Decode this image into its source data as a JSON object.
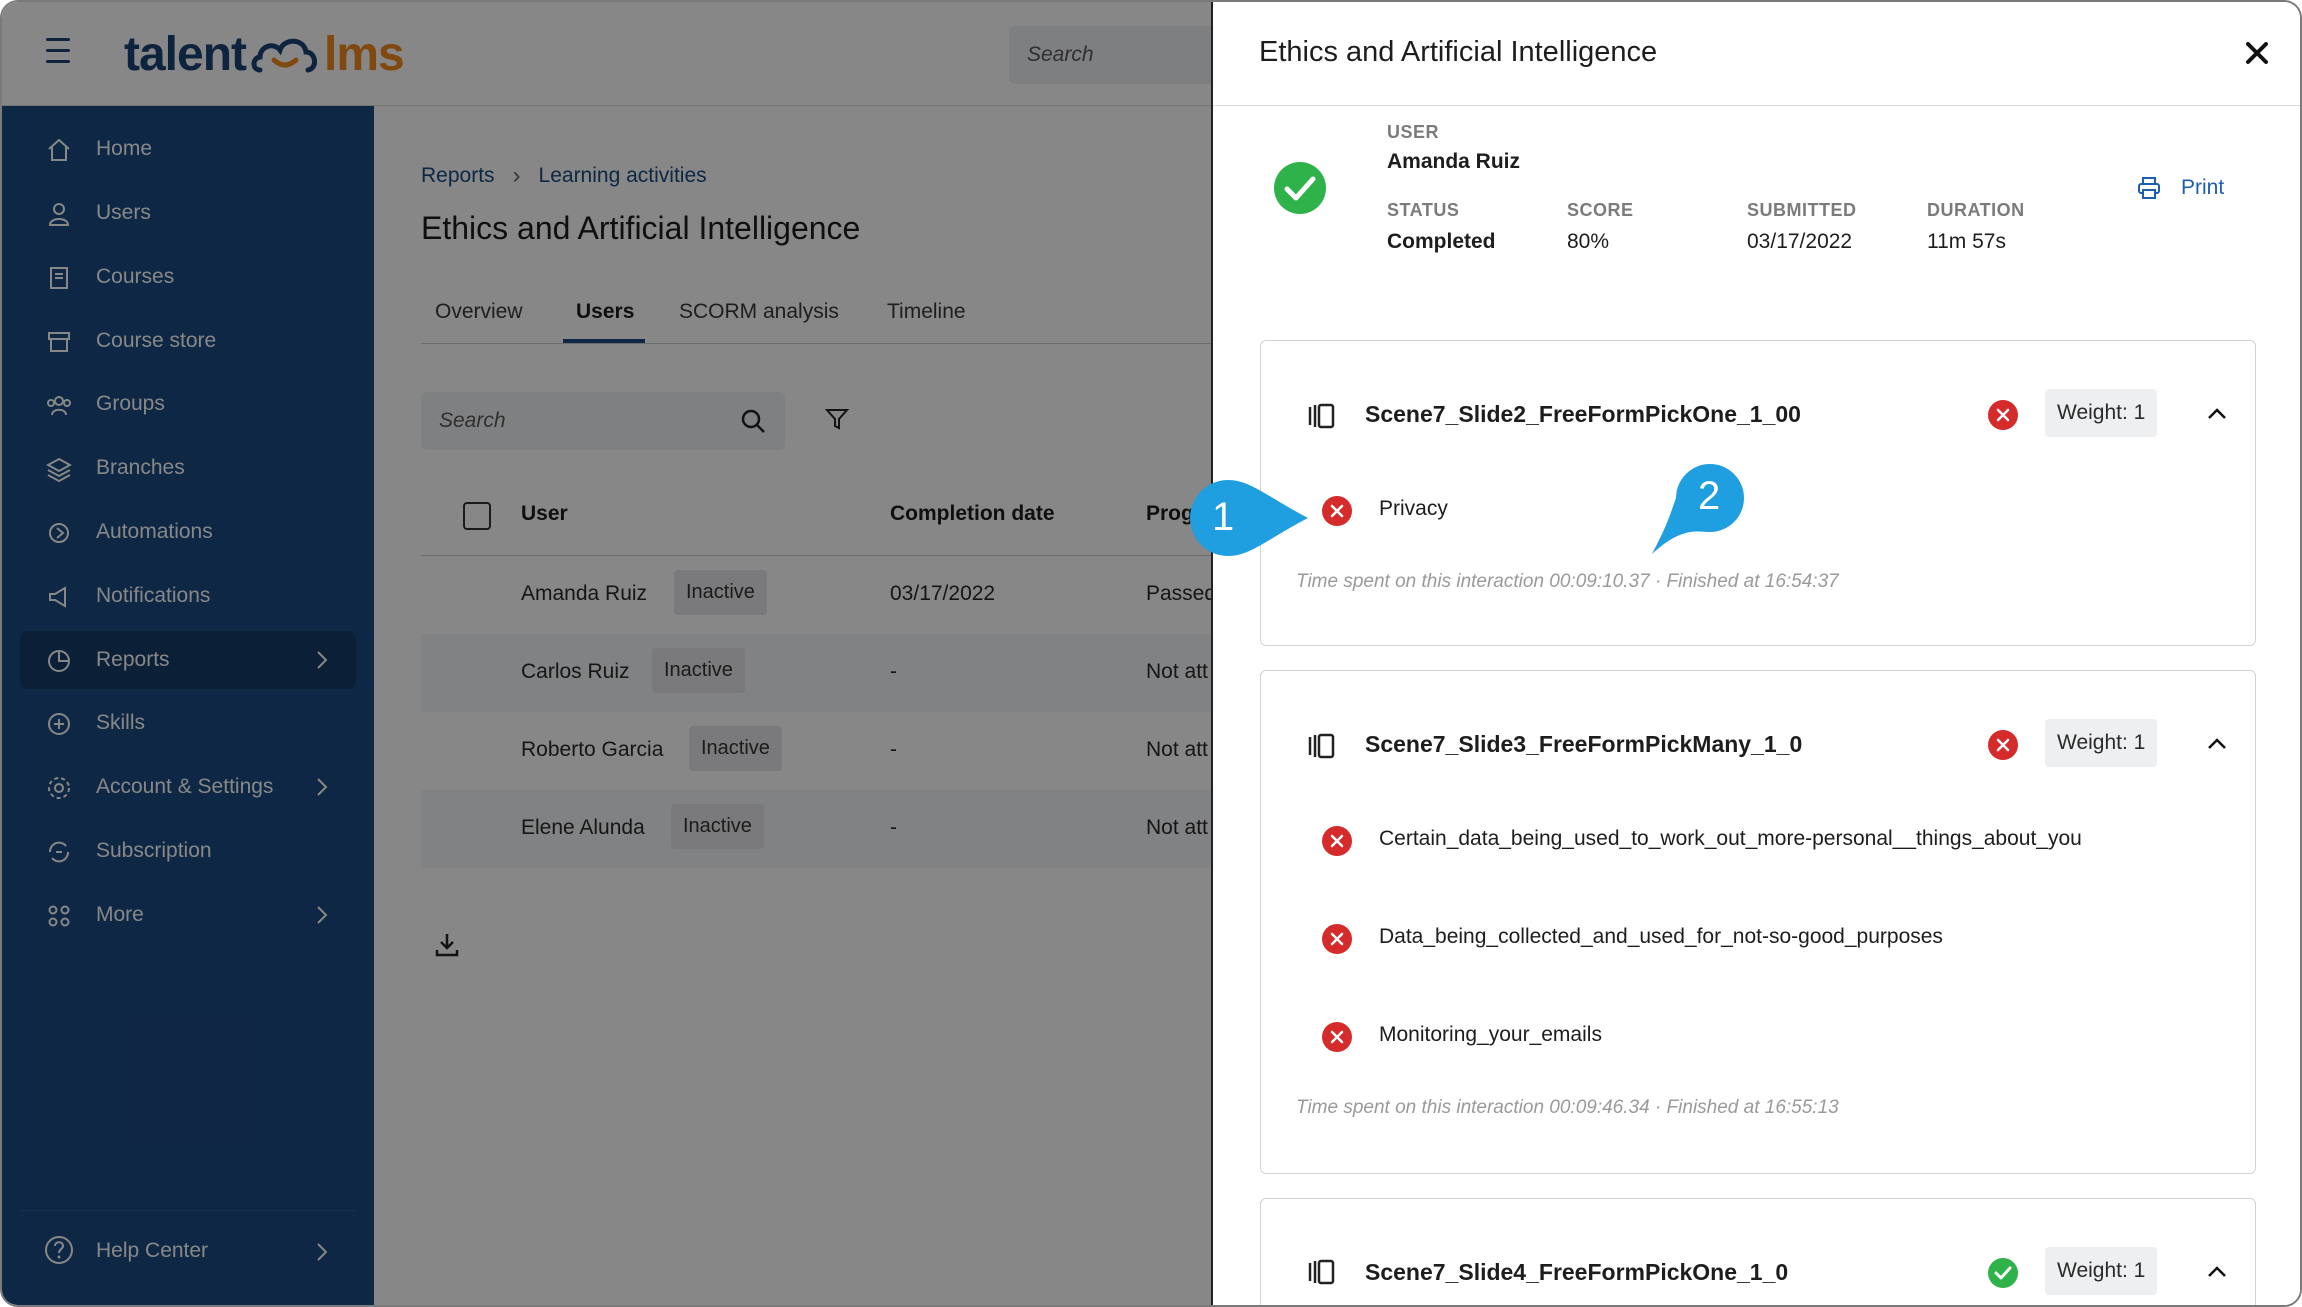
{
  "app": {
    "logo_left": "talent",
    "logo_right": "lms",
    "search_placeholder": "Search"
  },
  "sidebar": {
    "items": [
      {
        "label": "Home",
        "icon": "home-icon"
      },
      {
        "label": "Users",
        "icon": "user-icon"
      },
      {
        "label": "Courses",
        "icon": "book-icon"
      },
      {
        "label": "Course store",
        "icon": "store-icon"
      },
      {
        "label": "Groups",
        "icon": "groups-icon"
      },
      {
        "label": "Branches",
        "icon": "layers-icon"
      },
      {
        "label": "Automations",
        "icon": "automation-icon"
      },
      {
        "label": "Notifications",
        "icon": "megaphone-icon"
      },
      {
        "label": "Reports",
        "icon": "pie-chart-icon",
        "active": true
      },
      {
        "label": "Skills",
        "icon": "skills-icon"
      },
      {
        "label": "Account & Settings",
        "icon": "gear-icon"
      },
      {
        "label": "Subscription",
        "icon": "subscription-icon"
      },
      {
        "label": "More",
        "icon": "grid-icon"
      }
    ],
    "help": "Help Center"
  },
  "main": {
    "breadcrumb": [
      "Reports",
      "Learning activities"
    ],
    "title": "Ethics and Artificial Intelligence",
    "tabs": [
      "Overview",
      "Users",
      "SCORM analysis",
      "Timeline"
    ],
    "active_tab": "Users",
    "search_placeholder": "Search",
    "columns": [
      "User",
      "Completion date",
      "Prog"
    ],
    "rows": [
      {
        "user": "Amanda Ruiz",
        "status": "Inactive",
        "date": "03/17/2022",
        "progress": "Passed"
      },
      {
        "user": "Carlos Ruiz",
        "status": "Inactive",
        "date": "-",
        "progress": "Not att"
      },
      {
        "user": "Roberto Garcia",
        "status": "Inactive",
        "date": "-",
        "progress": "Not att"
      },
      {
        "user": "Elene Alunda",
        "status": "Inactive",
        "date": "-",
        "progress": "Not att"
      }
    ]
  },
  "drawer": {
    "title": "Ethics and Artificial Intelligence",
    "user_label": "USER",
    "user_name": "Amanda Ruiz",
    "status_label": "STATUS",
    "status_value": "Completed",
    "score_label": "SCORE",
    "score_value": "80%",
    "submitted_label": "SUBMITTED",
    "submitted_value": "03/17/2022",
    "duration_label": "DURATION",
    "duration_value": "11m 57s",
    "print": "Print",
    "questions": [
      {
        "title": "Scene7_Slide2_FreeFormPickOne_1_00",
        "correct": false,
        "weight": "Weight: 1",
        "answers": [
          "Privacy"
        ],
        "meta": "Time spent on this interaction 00:09:10.37 · Finished at 16:54:37"
      },
      {
        "title": "Scene7_Slide3_FreeFormPickMany_1_0",
        "correct": false,
        "weight": "Weight: 1",
        "answers": [
          "Certain_data_being_used_to_work_out_more-personal__things_about_you",
          "Data_being_collected_and_used_for_not-so-good_purposes",
          "Monitoring_your_emails"
        ],
        "meta": "Time spent on this interaction 00:09:46.34 · Finished at 16:55:13"
      },
      {
        "title": "Scene7_Slide4_FreeFormPickOne_1_0",
        "correct": true,
        "weight": "Weight: 1"
      }
    ]
  },
  "callouts": [
    "1",
    "2"
  ],
  "colors": {
    "brand_blue": "#1c4a80",
    "brand_orange": "#f28a1e",
    "error_red": "#d52b2b",
    "success_green": "#2fb24a",
    "callout_blue": "#1f9fe0"
  }
}
